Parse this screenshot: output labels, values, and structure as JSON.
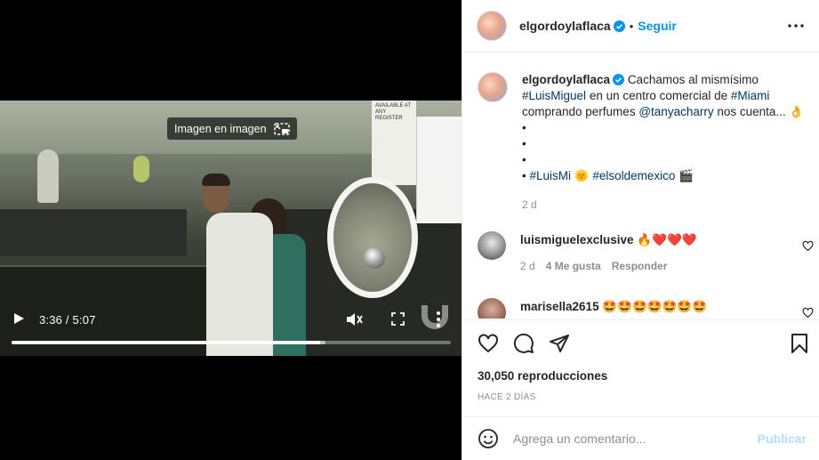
{
  "video": {
    "pip_label": "Imagen en imagen",
    "time_display": "3:36 / 5:07",
    "progress_fraction": 0.703,
    "buffered_fraction": 0.715,
    "sign_text": "AVAILABLE AT ANY REGISTER"
  },
  "header": {
    "username": "elgordoylaflaca",
    "separator": "•",
    "follow_label": "Seguir"
  },
  "caption": {
    "username": "elgordoylaflaca",
    "text_1": "Cachamos al mismísimo",
    "tag_luismiguel": "#LuisMiguel",
    "text_2": "en un centro comercial de",
    "tag_miami": "#Miami",
    "text_3": "comprando perfumes",
    "mention": "@tanyacharry",
    "text_4": "nos cuenta... 👌",
    "bullet": "•",
    "tag_luismi": "#LuisMi",
    "sun_emoji": "🌞",
    "tag_elsoldemexico": "#elsoldemexico",
    "clapper_emoji": "🎬",
    "age": "2 d"
  },
  "comments": [
    {
      "username": "luismiguelexclusive",
      "text": "🔥❤️❤️❤️",
      "age": "2 d",
      "likes": "4 Me gusta",
      "reply_label": "Responder"
    },
    {
      "username": "marisella2615",
      "text": "🤩🤩🤩🤩🤩🤩🤩"
    }
  ],
  "stats": {
    "views": "30,050 reproducciones",
    "posted": "HACE 2 DÍAS"
  },
  "composer": {
    "placeholder": "Agrega un comentario...",
    "post_label": "Publicar"
  },
  "colors": {
    "accent": "#0095f6",
    "link": "#00376b",
    "muted": "#8e8e8e",
    "post_disabled": "#b2dffc",
    "verified": "#0095f6",
    "like_red": "#ed4956"
  }
}
